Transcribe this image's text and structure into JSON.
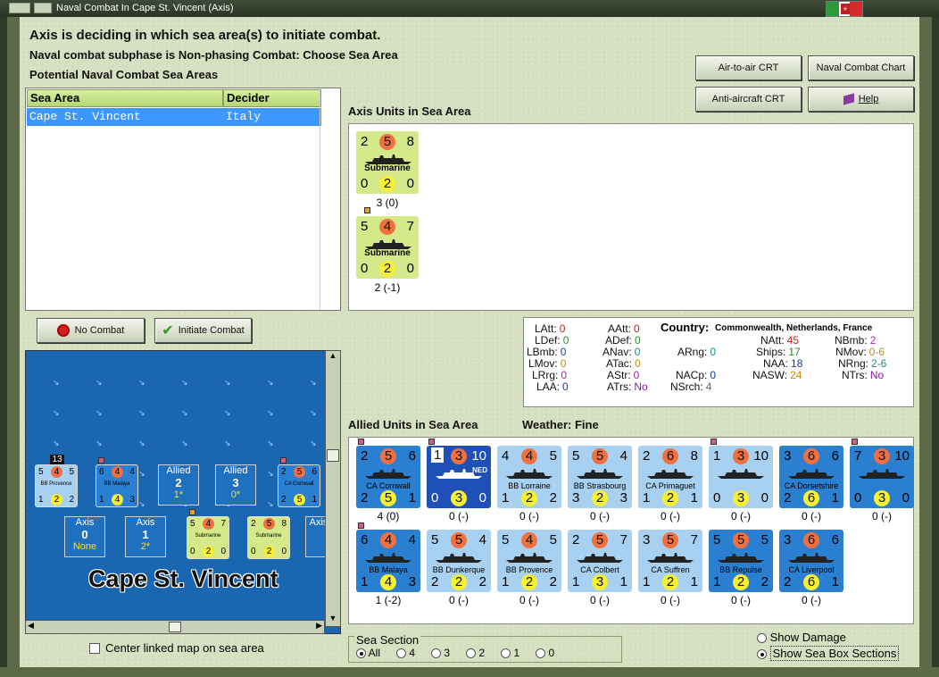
{
  "window": {
    "title": "Naval Combat In Cape St. Vincent (Axis)"
  },
  "messages": {
    "line1": "Axis is deciding in which sea area(s) to initiate combat.",
    "line2": "Naval combat subphase is Non-phasing Combat: Choose Sea Area",
    "line3": "Potential Naval Combat Sea Areas"
  },
  "buttons": {
    "air_crt": "Air-to-air CRT",
    "naval_chart": "Naval Combat Chart",
    "aa_crt": "Anti-aircraft CRT",
    "help": "Help",
    "no_combat": "No Combat",
    "initiate": "Initiate Combat"
  },
  "table": {
    "headers": [
      "Sea Area",
      "Decider"
    ],
    "rows": [
      [
        "Cape St. Vincent",
        "Italy"
      ]
    ]
  },
  "axis_label": "Axis Units in Sea Area",
  "axis_units": [
    {
      "tl": "2",
      "tc": "5",
      "tr": "8",
      "name": "Submarine",
      "bl": "0",
      "bc": "2",
      "br": "0",
      "caption": "3 (0)"
    },
    {
      "tl": "5",
      "tc": "4",
      "tr": "7",
      "name": "Submarine",
      "bl": "0",
      "bc": "2",
      "br": "0",
      "caption": "2 (-1)"
    }
  ],
  "stats": {
    "LAtt": "0",
    "LDef": "0",
    "LBmb": "0",
    "LMov": "0",
    "LRrg": "0",
    "LAA": "0",
    "AAtt": "0",
    "ADef": "0",
    "ANav": "0",
    "ATac": "0",
    "AStr": "0",
    "ATrs": "No",
    "ARng": "0",
    "NACp": "0",
    "NSrch": "4",
    "country_label": "Country:",
    "country": "Commonwealth, Netherlands, France",
    "NAtt": "45",
    "Ships": "17",
    "NAA": "18",
    "NASW": "24",
    "NBmb": "2",
    "NMov": "0-6",
    "NRng": "2-6",
    "NTrs": "No"
  },
  "allied_label": "Allied Units in Sea Area",
  "weather": "Weather:  Fine",
  "allied_units": [
    {
      "tl": "2",
      "tc": "5",
      "tr": "6",
      "name": "CA Cornwall",
      "bl": "2",
      "bc": "5",
      "br": "1",
      "caption": "4 (0)",
      "style": "dark"
    },
    {
      "tl": "1",
      "tc": "3",
      "tr": "10",
      "name": "NED",
      "bl": "0",
      "bc": "3",
      "br": "0",
      "caption": "0 (-)",
      "style": "navy"
    },
    {
      "tl": "4",
      "tc": "4",
      "tr": "5",
      "name": "BB Lorraine",
      "bl": "1",
      "bc": "2",
      "br": "2",
      "caption": "0 (-)",
      "style": "light"
    },
    {
      "tl": "5",
      "tc": "5",
      "tr": "4",
      "name": "BB Strasbourg",
      "bl": "3",
      "bc": "2",
      "br": "3",
      "caption": "0 (-)",
      "style": "light"
    },
    {
      "tl": "2",
      "tc": "6",
      "tr": "8",
      "name": "CA Primaguet",
      "bl": "1",
      "bc": "2",
      "br": "1",
      "caption": "0 (-)",
      "style": "light"
    },
    {
      "tl": "1",
      "tc": "3",
      "tr": "10",
      "name": "",
      "bl": "0",
      "bc": "3",
      "br": "0",
      "caption": "0 (-)",
      "style": "light"
    },
    {
      "tl": "3",
      "tc": "6",
      "tr": "6",
      "name": "CA Dorsetshire",
      "bl": "2",
      "bc": "6",
      "br": "1",
      "caption": "0 (-)",
      "style": "dark"
    },
    {
      "tl": "7",
      "tc": "3",
      "tr": "10",
      "name": "",
      "bl": "0",
      "bc": "3",
      "br": "0",
      "caption": "0 (-)",
      "style": "dark"
    },
    {
      "tl": "6",
      "tc": "4",
      "tr": "4",
      "name": "BB Malaya",
      "bl": "1",
      "bc": "4",
      "br": "3",
      "caption": "1 (-2)",
      "style": "dark"
    },
    {
      "tl": "5",
      "tc": "5",
      "tr": "4",
      "name": "BB Dunkerque",
      "bl": "2",
      "bc": "2",
      "br": "2",
      "caption": "0 (-)",
      "style": "light"
    },
    {
      "tl": "5",
      "tc": "4",
      "tr": "5",
      "name": "BB Provence",
      "bl": "1",
      "bc": "2",
      "br": "2",
      "caption": "0 (-)",
      "style": "light"
    },
    {
      "tl": "2",
      "tc": "5",
      "tr": "7",
      "name": "CA Colbert",
      "bl": "1",
      "bc": "3",
      "br": "1",
      "caption": "0 (-)",
      "style": "light"
    },
    {
      "tl": "3",
      "tc": "5",
      "tr": "7",
      "name": "CA Suffren",
      "bl": "1",
      "bc": "2",
      "br": "1",
      "caption": "0 (-)",
      "style": "light"
    },
    {
      "tl": "5",
      "tc": "5",
      "tr": "5",
      "name": "BB Repulse",
      "bl": "1",
      "bc": "2",
      "br": "2",
      "caption": "0 (-)",
      "style": "dark"
    },
    {
      "tl": "3",
      "tc": "6",
      "tr": "6",
      "name": "CA Liverpool",
      "bl": "2",
      "bc": "6",
      "br": "1",
      "caption": "0 (-)",
      "style": "dark"
    }
  ],
  "map": {
    "title": "Cape St. Vincent",
    "badge": "13",
    "allied_box_label": "Allied",
    "axis_box_label": "Axis",
    "allied4": "2",
    "allied4_sub": "1*",
    "allied3": "3",
    "allied3_sub": "0*",
    "axis0": "0",
    "axis0_sub": "None",
    "axis1": "1",
    "axis1_sub": "2*",
    "units": [
      {
        "name": "BB Provence",
        "tl": "5",
        "tc": "4",
        "tr": "5",
        "bl": "1",
        "bc": "2",
        "br": "2"
      },
      {
        "name": "BB Malaya",
        "tl": "6",
        "tc": "4",
        "tr": "4",
        "bl": "1",
        "bc": "4",
        "br": "3"
      },
      {
        "name": "CA Cornwall",
        "tl": "2",
        "tc": "5",
        "tr": "6",
        "bl": "2",
        "bc": "5",
        "br": "1"
      },
      {
        "name": "Submarine",
        "tl": "5",
        "tc": "4",
        "tr": "7",
        "bl": "0",
        "bc": "2",
        "br": "0"
      },
      {
        "name": "Submarine",
        "tl": "2",
        "tc": "5",
        "tr": "8",
        "bl": "0",
        "bc": "2",
        "br": "0"
      }
    ]
  },
  "center_map": "Center linked map on sea area",
  "sea_section": {
    "label": "Sea Section",
    "options": [
      "All",
      "4",
      "3",
      "2",
      "1",
      "0"
    ],
    "selected": "All"
  },
  "show_damage": "Show Damage",
  "show_sections": "Show Sea Box Sections"
}
